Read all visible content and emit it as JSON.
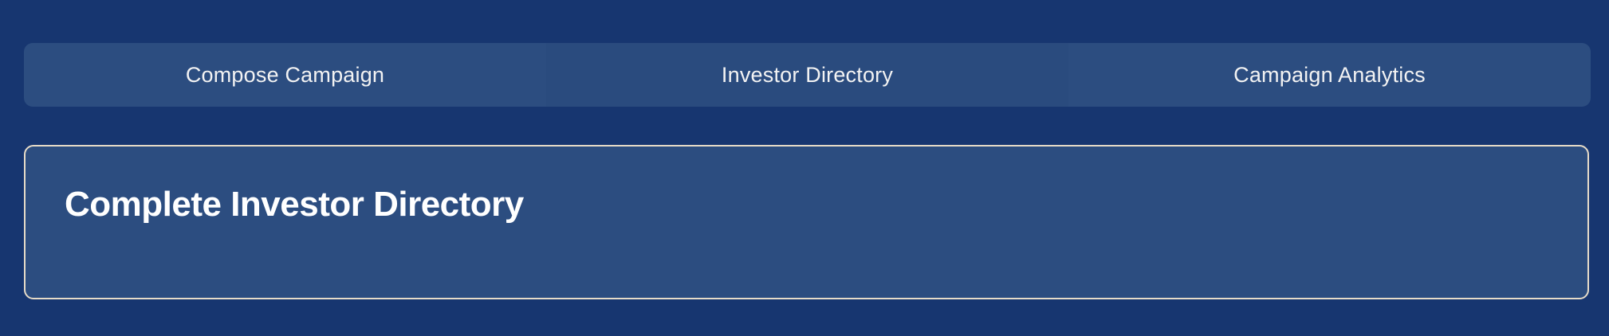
{
  "tabs": [
    {
      "label": "Compose Campaign"
    },
    {
      "label": "Investor Directory"
    },
    {
      "label": "Campaign Analytics"
    }
  ],
  "active_tab": "Investor Directory",
  "panel": {
    "title": "Complete Investor Directory"
  },
  "colors": {
    "background": "#173670",
    "surface": "#2c4d80",
    "panel_border": "#e7dcc8",
    "text": "#ffffff"
  }
}
